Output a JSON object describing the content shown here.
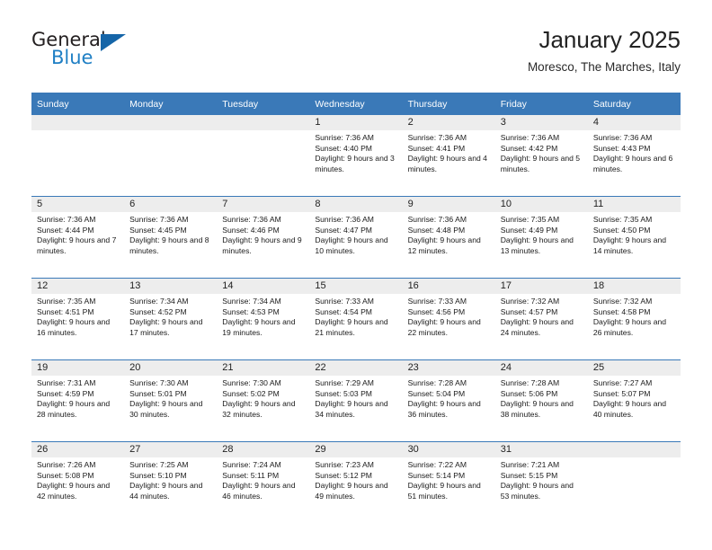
{
  "brand": {
    "name_part1": "General",
    "name_part2": "Blue",
    "logo_icon": "triangle-flag-icon"
  },
  "header": {
    "title": "January 2025",
    "subtitle": "Moresco, The Marches, Italy"
  },
  "calendar": {
    "weekday_headers": [
      "Sunday",
      "Monday",
      "Tuesday",
      "Wednesday",
      "Thursday",
      "Friday",
      "Saturday"
    ],
    "accent_color": "#3a79b8",
    "daynum_band_color": "#ededed",
    "weeks": [
      [
        {
          "day": "",
          "empty": true
        },
        {
          "day": "",
          "empty": true
        },
        {
          "day": "",
          "empty": true
        },
        {
          "day": "1",
          "sunrise": "Sunrise: 7:36 AM",
          "sunset": "Sunset: 4:40 PM",
          "daylight": "Daylight: 9 hours and 3 minutes."
        },
        {
          "day": "2",
          "sunrise": "Sunrise: 7:36 AM",
          "sunset": "Sunset: 4:41 PM",
          "daylight": "Daylight: 9 hours and 4 minutes."
        },
        {
          "day": "3",
          "sunrise": "Sunrise: 7:36 AM",
          "sunset": "Sunset: 4:42 PM",
          "daylight": "Daylight: 9 hours and 5 minutes."
        },
        {
          "day": "4",
          "sunrise": "Sunrise: 7:36 AM",
          "sunset": "Sunset: 4:43 PM",
          "daylight": "Daylight: 9 hours and 6 minutes."
        }
      ],
      [
        {
          "day": "5",
          "sunrise": "Sunrise: 7:36 AM",
          "sunset": "Sunset: 4:44 PM",
          "daylight": "Daylight: 9 hours and 7 minutes."
        },
        {
          "day": "6",
          "sunrise": "Sunrise: 7:36 AM",
          "sunset": "Sunset: 4:45 PM",
          "daylight": "Daylight: 9 hours and 8 minutes."
        },
        {
          "day": "7",
          "sunrise": "Sunrise: 7:36 AM",
          "sunset": "Sunset: 4:46 PM",
          "daylight": "Daylight: 9 hours and 9 minutes."
        },
        {
          "day": "8",
          "sunrise": "Sunrise: 7:36 AM",
          "sunset": "Sunset: 4:47 PM",
          "daylight": "Daylight: 9 hours and 10 minutes."
        },
        {
          "day": "9",
          "sunrise": "Sunrise: 7:36 AM",
          "sunset": "Sunset: 4:48 PM",
          "daylight": "Daylight: 9 hours and 12 minutes."
        },
        {
          "day": "10",
          "sunrise": "Sunrise: 7:35 AM",
          "sunset": "Sunset: 4:49 PM",
          "daylight": "Daylight: 9 hours and 13 minutes."
        },
        {
          "day": "11",
          "sunrise": "Sunrise: 7:35 AM",
          "sunset": "Sunset: 4:50 PM",
          "daylight": "Daylight: 9 hours and 14 minutes."
        }
      ],
      [
        {
          "day": "12",
          "sunrise": "Sunrise: 7:35 AM",
          "sunset": "Sunset: 4:51 PM",
          "daylight": "Daylight: 9 hours and 16 minutes."
        },
        {
          "day": "13",
          "sunrise": "Sunrise: 7:34 AM",
          "sunset": "Sunset: 4:52 PM",
          "daylight": "Daylight: 9 hours and 17 minutes."
        },
        {
          "day": "14",
          "sunrise": "Sunrise: 7:34 AM",
          "sunset": "Sunset: 4:53 PM",
          "daylight": "Daylight: 9 hours and 19 minutes."
        },
        {
          "day": "15",
          "sunrise": "Sunrise: 7:33 AM",
          "sunset": "Sunset: 4:54 PM",
          "daylight": "Daylight: 9 hours and 21 minutes."
        },
        {
          "day": "16",
          "sunrise": "Sunrise: 7:33 AM",
          "sunset": "Sunset: 4:56 PM",
          "daylight": "Daylight: 9 hours and 22 minutes."
        },
        {
          "day": "17",
          "sunrise": "Sunrise: 7:32 AM",
          "sunset": "Sunset: 4:57 PM",
          "daylight": "Daylight: 9 hours and 24 minutes."
        },
        {
          "day": "18",
          "sunrise": "Sunrise: 7:32 AM",
          "sunset": "Sunset: 4:58 PM",
          "daylight": "Daylight: 9 hours and 26 minutes."
        }
      ],
      [
        {
          "day": "19",
          "sunrise": "Sunrise: 7:31 AM",
          "sunset": "Sunset: 4:59 PM",
          "daylight": "Daylight: 9 hours and 28 minutes."
        },
        {
          "day": "20",
          "sunrise": "Sunrise: 7:30 AM",
          "sunset": "Sunset: 5:01 PM",
          "daylight": "Daylight: 9 hours and 30 minutes."
        },
        {
          "day": "21",
          "sunrise": "Sunrise: 7:30 AM",
          "sunset": "Sunset: 5:02 PM",
          "daylight": "Daylight: 9 hours and 32 minutes."
        },
        {
          "day": "22",
          "sunrise": "Sunrise: 7:29 AM",
          "sunset": "Sunset: 5:03 PM",
          "daylight": "Daylight: 9 hours and 34 minutes."
        },
        {
          "day": "23",
          "sunrise": "Sunrise: 7:28 AM",
          "sunset": "Sunset: 5:04 PM",
          "daylight": "Daylight: 9 hours and 36 minutes."
        },
        {
          "day": "24",
          "sunrise": "Sunrise: 7:28 AM",
          "sunset": "Sunset: 5:06 PM",
          "daylight": "Daylight: 9 hours and 38 minutes."
        },
        {
          "day": "25",
          "sunrise": "Sunrise: 7:27 AM",
          "sunset": "Sunset: 5:07 PM",
          "daylight": "Daylight: 9 hours and 40 minutes."
        }
      ],
      [
        {
          "day": "26",
          "sunrise": "Sunrise: 7:26 AM",
          "sunset": "Sunset: 5:08 PM",
          "daylight": "Daylight: 9 hours and 42 minutes."
        },
        {
          "day": "27",
          "sunrise": "Sunrise: 7:25 AM",
          "sunset": "Sunset: 5:10 PM",
          "daylight": "Daylight: 9 hours and 44 minutes."
        },
        {
          "day": "28",
          "sunrise": "Sunrise: 7:24 AM",
          "sunset": "Sunset: 5:11 PM",
          "daylight": "Daylight: 9 hours and 46 minutes."
        },
        {
          "day": "29",
          "sunrise": "Sunrise: 7:23 AM",
          "sunset": "Sunset: 5:12 PM",
          "daylight": "Daylight: 9 hours and 49 minutes."
        },
        {
          "day": "30",
          "sunrise": "Sunrise: 7:22 AM",
          "sunset": "Sunset: 5:14 PM",
          "daylight": "Daylight: 9 hours and 51 minutes."
        },
        {
          "day": "31",
          "sunrise": "Sunrise: 7:21 AM",
          "sunset": "Sunset: 5:15 PM",
          "daylight": "Daylight: 9 hours and 53 minutes."
        },
        {
          "day": "",
          "empty": true
        }
      ]
    ]
  }
}
